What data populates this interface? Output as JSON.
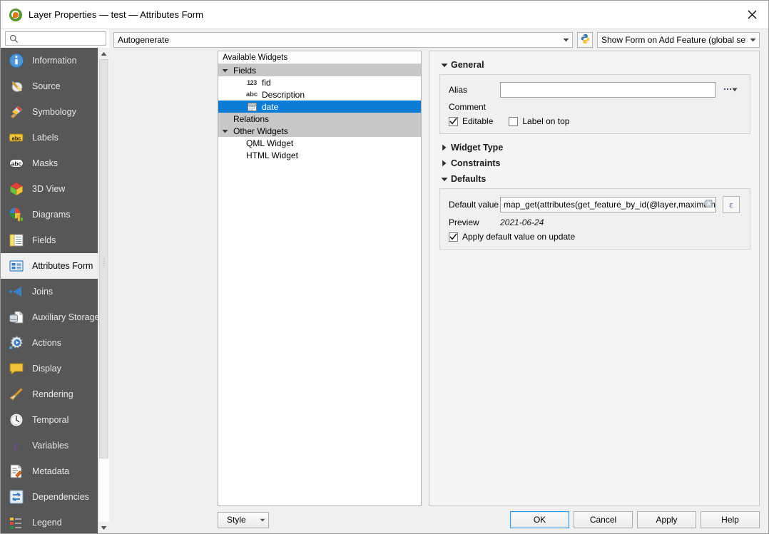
{
  "window": {
    "title": "Layer Properties — test — Attributes Form",
    "app_icon": "qgis-logo-icon",
    "close_icon": "close-icon"
  },
  "sidebar": {
    "search": {
      "value": "",
      "placeholder": "",
      "icon": "search-icon"
    },
    "items": [
      {
        "label": "Information",
        "icon": "information-icon",
        "selected": false
      },
      {
        "label": "Source",
        "icon": "source-icon",
        "selected": false
      },
      {
        "label": "Symbology",
        "icon": "symbology-icon",
        "selected": false
      },
      {
        "label": "Labels",
        "icon": "labels-icon",
        "selected": false
      },
      {
        "label": "Masks",
        "icon": "masks-icon",
        "selected": false
      },
      {
        "label": "3D View",
        "icon": "3d-view-icon",
        "selected": false
      },
      {
        "label": "Diagrams",
        "icon": "diagrams-icon",
        "selected": false
      },
      {
        "label": "Fields",
        "icon": "fields-icon",
        "selected": false
      },
      {
        "label": "Attributes Form",
        "icon": "attributes-form-icon",
        "selected": true
      },
      {
        "label": "Joins",
        "icon": "joins-icon",
        "selected": false
      },
      {
        "label": "Auxiliary Storage",
        "icon": "auxiliary-storage-icon",
        "selected": false
      },
      {
        "label": "Actions",
        "icon": "actions-icon",
        "selected": false
      },
      {
        "label": "Display",
        "icon": "display-icon",
        "selected": false
      },
      {
        "label": "Rendering",
        "icon": "rendering-icon",
        "selected": false
      },
      {
        "label": "Temporal",
        "icon": "temporal-icon",
        "selected": false
      },
      {
        "label": "Variables",
        "icon": "variables-icon",
        "selected": false
      },
      {
        "label": "Metadata",
        "icon": "metadata-icon",
        "selected": false
      },
      {
        "label": "Dependencies",
        "icon": "dependencies-icon",
        "selected": false
      },
      {
        "label": "Legend",
        "icon": "legend-icon",
        "selected": false
      }
    ],
    "scrollbar": {
      "up_icon": "scroll-up-icon",
      "down_icon": "scroll-down-icon"
    }
  },
  "toolbar": {
    "layout_combo": {
      "value": "Autogenerate",
      "arrow_icon": "chevron-down-icon"
    },
    "python_button": {
      "icon": "python-icon"
    },
    "form_suppress_combo": {
      "value": "Show Form on Add Feature (global settings)",
      "arrow_icon": "chevron-down-icon"
    }
  },
  "tree": {
    "header": "Available Widgets",
    "rows": [
      {
        "label": "Fields",
        "kind": "group",
        "twisty": "expanded",
        "icon": "",
        "indent": 0,
        "selected": false
      },
      {
        "label": "fid",
        "kind": "field",
        "twisty": "",
        "icon": "number-icon",
        "indent": 1,
        "selected": false
      },
      {
        "label": "Description",
        "kind": "field",
        "twisty": "",
        "icon": "text-icon",
        "indent": 1,
        "selected": false
      },
      {
        "label": "date",
        "kind": "field",
        "twisty": "",
        "icon": "date-icon",
        "indent": 1,
        "selected": true
      },
      {
        "label": "Relations",
        "kind": "group",
        "twisty": "",
        "icon": "",
        "indent": 0,
        "selected": false
      },
      {
        "label": "Other Widgets",
        "kind": "group",
        "twisty": "expanded",
        "icon": "",
        "indent": 0,
        "selected": false
      },
      {
        "label": "QML Widget",
        "kind": "leaf",
        "twisty": "",
        "icon": "",
        "indent": 1,
        "selected": false
      },
      {
        "label": "HTML Widget",
        "kind": "leaf",
        "twisty": "",
        "icon": "",
        "indent": 1,
        "selected": false
      }
    ],
    "icon_glyphs": {
      "number-icon": "123",
      "text-icon": "abc"
    }
  },
  "properties": {
    "general": {
      "title": "General",
      "expanded": true,
      "twisty_icon": "triangle-down-icon",
      "alias_label": "Alias",
      "alias_value": "",
      "alias_placeholder": "",
      "override_button_icon": "data-defined-override-icon",
      "comment_label": "Comment",
      "editable": {
        "label": "Editable",
        "checked": true,
        "icon": "checkmark-icon"
      },
      "label_on_top": {
        "label": "Label on top",
        "checked": false,
        "icon": "checkmark-icon"
      }
    },
    "widget_type": {
      "title": "Widget Type",
      "expanded": false,
      "twisty_icon": "triangle-right-icon"
    },
    "constraints": {
      "title": "Constraints",
      "expanded": false,
      "twisty_icon": "triangle-right-icon"
    },
    "defaults": {
      "title": "Defaults",
      "expanded": true,
      "twisty_icon": "triangle-down-icon",
      "default_value_label": "Default value",
      "default_value": "map_get(attributes(get_feature_by_id(@layer,maximum(\"fid\"))),'date')",
      "clear_icon": "clear-icon",
      "expression_button_icon": "expression-epsilon-icon",
      "expression_button_glyph": "ε",
      "preview_label": "Preview",
      "preview_value": "2021-06-24",
      "apply_on_update": {
        "label": "Apply default value on update",
        "checked": true,
        "icon": "checkmark-icon"
      }
    }
  },
  "footer": {
    "style_button": {
      "label": "Style",
      "arrow_icon": "chevron-down-icon"
    },
    "buttons": [
      {
        "label": "OK",
        "default": true
      },
      {
        "label": "Cancel",
        "default": false
      },
      {
        "label": "Apply",
        "default": false
      },
      {
        "label": "Help",
        "default": false
      }
    ]
  },
  "colors": {
    "sidebar_bg": "#575757",
    "selection_blue": "#0a7cd6",
    "window_bg": "#f0f0f0",
    "group_row": "#c8c8c8",
    "accent_default_button": "#3399dd"
  }
}
